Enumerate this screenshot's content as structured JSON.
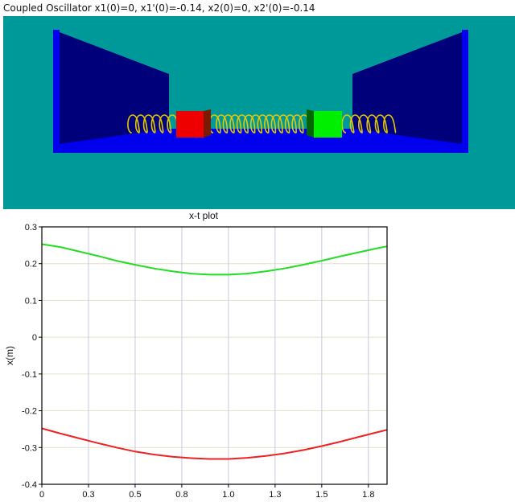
{
  "window": {
    "title": "Coupled Oscillator x1(0)=0, x1'(0)=-0.14, x2(0)=0, x2'(0)=-0.14"
  },
  "scene": {
    "colors": {
      "background": "#009999",
      "walls": "#00007a",
      "floor": "#0000ee",
      "mass1": "#ee0000",
      "mass2": "#00ee00",
      "springs": "#e6c800"
    }
  },
  "plot": {
    "title": "x-t plot",
    "ylabel": "x(m)"
  },
  "chart_data": {
    "type": "line",
    "title": "x-t plot",
    "xlabel": "",
    "ylabel": "x(m)",
    "xlim": [
      0,
      1.85
    ],
    "ylim": [
      -0.4,
      0.3
    ],
    "xticks": [
      "0",
      "0.3",
      "0.5",
      "0.8",
      "1.0",
      "1.3",
      "1.5",
      "1.8"
    ],
    "xtick_values": [
      0,
      0.25,
      0.5,
      0.75,
      1.0,
      1.25,
      1.5,
      1.75
    ],
    "yticks": [
      "0.3",
      "0.2",
      "0.1",
      "0",
      "-0.1",
      "-0.2",
      "-0.3",
      "-0.4"
    ],
    "ytick_values": [
      0.3,
      0.2,
      0.1,
      0,
      -0.1,
      -0.2,
      -0.3,
      -0.4
    ],
    "grid": true,
    "series": [
      {
        "color": "#22dd22",
        "x": [
          0,
          0.1,
          0.2,
          0.3,
          0.4,
          0.5,
          0.6,
          0.7,
          0.8,
          0.9,
          0.95,
          1.0,
          1.1,
          1.2,
          1.3,
          1.4,
          1.5,
          1.6,
          1.7,
          1.8,
          1.85
        ],
        "y": [
          0.253,
          0.245,
          0.233,
          0.221,
          0.208,
          0.197,
          0.187,
          0.179,
          0.173,
          0.17,
          0.17,
          0.17,
          0.173,
          0.179,
          0.187,
          0.197,
          0.208,
          0.22,
          0.231,
          0.242,
          0.247
        ]
      },
      {
        "color": "#ee2222",
        "x": [
          0,
          0.1,
          0.2,
          0.3,
          0.4,
          0.5,
          0.6,
          0.7,
          0.8,
          0.9,
          0.95,
          1.0,
          1.1,
          1.2,
          1.3,
          1.4,
          1.5,
          1.6,
          1.7,
          1.8,
          1.85
        ],
        "y": [
          -0.248,
          -0.262,
          -0.275,
          -0.288,
          -0.3,
          -0.311,
          -0.319,
          -0.325,
          -0.329,
          -0.331,
          -0.331,
          -0.331,
          -0.328,
          -0.323,
          -0.316,
          -0.307,
          -0.296,
          -0.284,
          -0.271,
          -0.258,
          -0.252
        ]
      }
    ]
  }
}
